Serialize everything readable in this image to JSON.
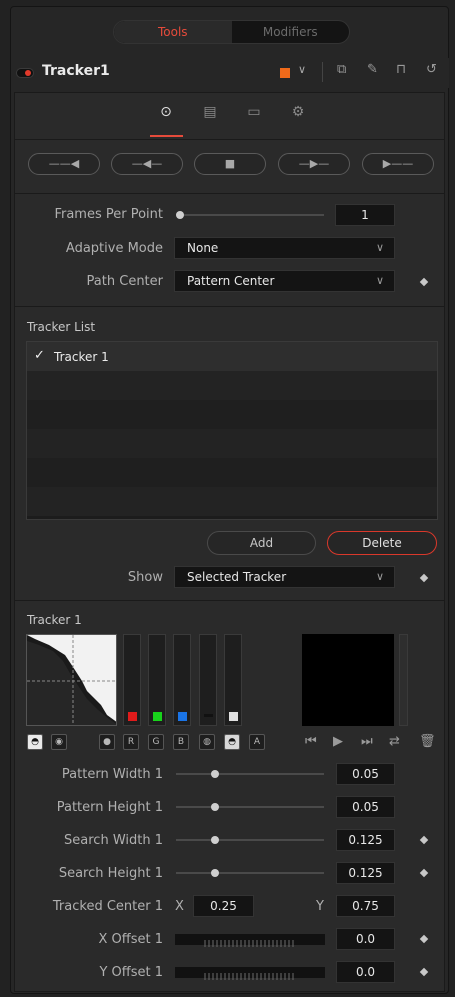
{
  "top_switch": {
    "tools": "Tools",
    "modifiers": "Modifiers"
  },
  "header": {
    "title": "Tracker1",
    "color_swatch": "#ef6a1a"
  },
  "tabs": [
    "tracker-controls",
    "operation",
    "display",
    "options"
  ],
  "track_buttons": [
    "track-reverse",
    "track-reverse-from-frame",
    "stop-tracking",
    "track-forward-from-frame",
    "track-forward"
  ],
  "settings": {
    "frames_per_point": {
      "label": "Frames Per Point",
      "value": "1",
      "slider_fraction": 0.0
    },
    "adaptive_mode": {
      "label": "Adaptive Mode",
      "value": "None"
    },
    "path_center": {
      "label": "Path Center",
      "value": "Pattern Center"
    }
  },
  "tracker_list": {
    "title": "Tracker List",
    "items": [
      {
        "check": "✓",
        "name": "Tracker 1"
      }
    ],
    "add_label": "Add",
    "delete_label": "Delete",
    "show_label": "Show",
    "show_value": "Selected Tracker"
  },
  "tracker_detail": {
    "title": "Tracker 1",
    "channels": [
      "R",
      "G",
      "B",
      "A"
    ],
    "channel_colors": {
      "r": "#e01b1b",
      "g": "#18d41b",
      "b": "#1a74e6",
      "luma": "#e0e0e0"
    }
  },
  "params": {
    "pattern_width": {
      "label": "Pattern Width 1",
      "value": "0.05",
      "slider_fraction": 0.28
    },
    "pattern_height": {
      "label": "Pattern Height 1",
      "value": "0.05",
      "slider_fraction": 0.28
    },
    "search_width": {
      "label": "Search Width 1",
      "value": "0.125",
      "slider_fraction": 0.28
    },
    "search_height": {
      "label": "Search Height 1",
      "value": "0.125",
      "slider_fraction": 0.28
    },
    "tracked_center": {
      "label": "Tracked Center 1",
      "x_label": "X",
      "x_value": "0.25",
      "y_label": "Y",
      "y_value": "0.75"
    },
    "x_offset": {
      "label": "X Offset 1",
      "value": "0.0"
    },
    "y_offset": {
      "label": "Y Offset 1",
      "value": "0.0"
    }
  },
  "accent_color": "#e64b3b"
}
